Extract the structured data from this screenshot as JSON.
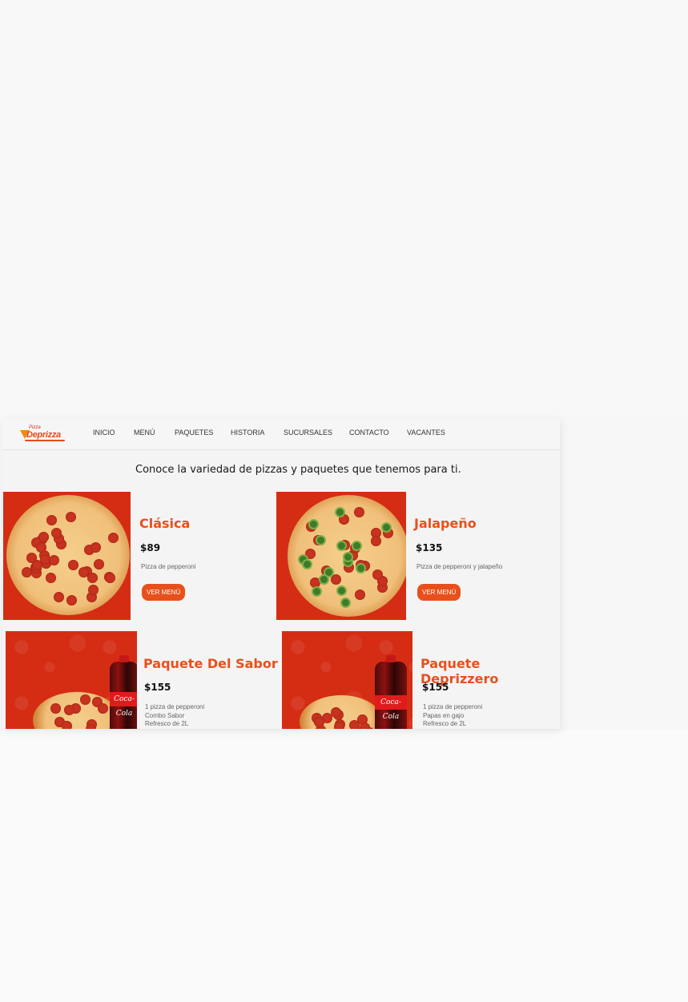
{
  "brand": {
    "logo_small": "Pizza",
    "logo_big": "Deprizza"
  },
  "nav": {
    "items": [
      "INICIO",
      "MENÚ",
      "PAQUETES",
      "HISTORIA",
      "SUCURSALES",
      "CONTACTO",
      "VACANTES"
    ]
  },
  "headline": "Conoce la variedad de pizzas y paquetes que tenemos para ti.",
  "cards": [
    {
      "title": "Clásica",
      "price": "$89",
      "desc": [
        "Pizza de pepperoni"
      ],
      "button": "VER MENÚ"
    },
    {
      "title": "Jalapeño",
      "price": "$135",
      "desc": [
        "Pizza de pepperoni y jalapeño"
      ],
      "button": "VER MENÚ"
    },
    {
      "title": "Paquete Del Sabor",
      "price": "$155",
      "desc": [
        "1 pizza de pepperoni",
        "Combo Sabor",
        "Refresco de 2L"
      ]
    },
    {
      "title": "Paquete Deprizzero",
      "price": "$155",
      "desc": [
        "1 pizza de pepperoni",
        "Papas en gajo",
        "Refresco de 2L"
      ]
    }
  ],
  "bottle_label": "Coca-Cola",
  "colors": {
    "accent": "#e8501b",
    "card_bg": "#d42d14",
    "page_bg": "#f4f4f4"
  },
  "icons": [
    "pizza-logo-icon",
    "pizza-image",
    "cola-bottle-image"
  ]
}
